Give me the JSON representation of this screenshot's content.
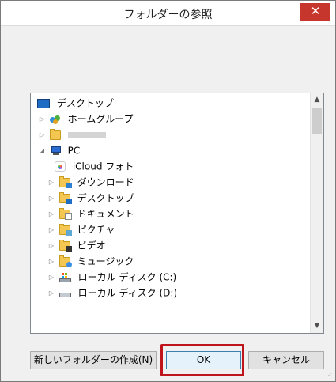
{
  "dialog": {
    "title": "フォルダーの参照",
    "close_glyph": "✕"
  },
  "tree": {
    "items": [
      {
        "label": "デスクトップ",
        "icon": "desktop-icon",
        "expander": ""
      },
      {
        "label": "ホームグループ",
        "icon": "homegroup-icon",
        "expander": "▷"
      },
      {
        "label": "",
        "icon": "user-icon",
        "expander": "▷"
      },
      {
        "label": "PC",
        "icon": "pc-icon",
        "expander": "◢"
      },
      {
        "label": "iCloud フォト",
        "icon": "icloud-photos-icon",
        "expander": ""
      },
      {
        "label": "ダウンロード",
        "icon": "downloads-folder-icon",
        "expander": "▷"
      },
      {
        "label": "デスクトップ",
        "icon": "desktop-folder-icon",
        "expander": "▷"
      },
      {
        "label": "ドキュメント",
        "icon": "documents-folder-icon",
        "expander": "▷"
      },
      {
        "label": "ピクチャ",
        "icon": "pictures-folder-icon",
        "expander": "▷"
      },
      {
        "label": "ビデオ",
        "icon": "videos-folder-icon",
        "expander": "▷"
      },
      {
        "label": "ミュージック",
        "icon": "music-folder-icon",
        "expander": "▷"
      },
      {
        "label": "ローカル ディスク (C:)",
        "icon": "local-disk-c-icon",
        "expander": "▷"
      },
      {
        "label": "ローカル ディスク (D:)",
        "icon": "local-disk-d-icon",
        "expander": "▷"
      }
    ]
  },
  "buttons": {
    "new_folder": "新しいフォルダーの作成(N)",
    "ok": "OK",
    "cancel": "キャンセル"
  },
  "colors": {
    "close_button": "#c7362c",
    "ok_highlight": "#c0141d"
  }
}
